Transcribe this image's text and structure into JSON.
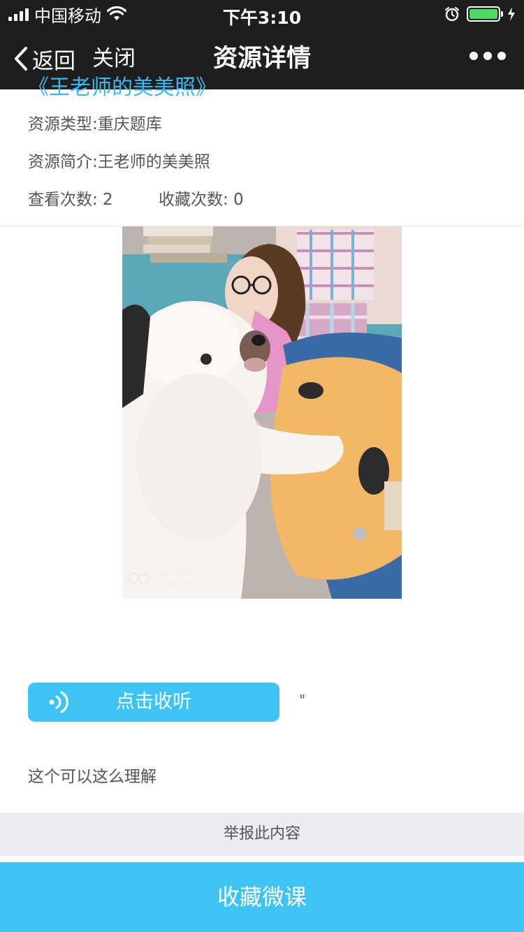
{
  "status_bar": {
    "carrier": "中国移动",
    "time": "下午3:10"
  },
  "nav": {
    "back_label": "返回",
    "close_label": "关闭",
    "title": "资源详情"
  },
  "resource": {
    "title_cut": "《王老师的美美照》",
    "type_line": "资源类型:重庆题库",
    "intro_line": "资源简介:王老师的美美照",
    "views_line": "查看次数: 2",
    "favorites_line": "收藏次数: 0",
    "photo_watermark_line1": "Shot on S10",
    "photo_watermark_line2": "Gionee Selfie Flash"
  },
  "audio": {
    "button_label": "点击收听",
    "side_text": "\""
  },
  "description": "这个可以这么理解",
  "report_label": "举报此内容",
  "collect_label": "收藏微课",
  "colors": {
    "accent": "#3ec4f2",
    "header_bg": "#1e1e1e",
    "battery": "#4cd964"
  }
}
